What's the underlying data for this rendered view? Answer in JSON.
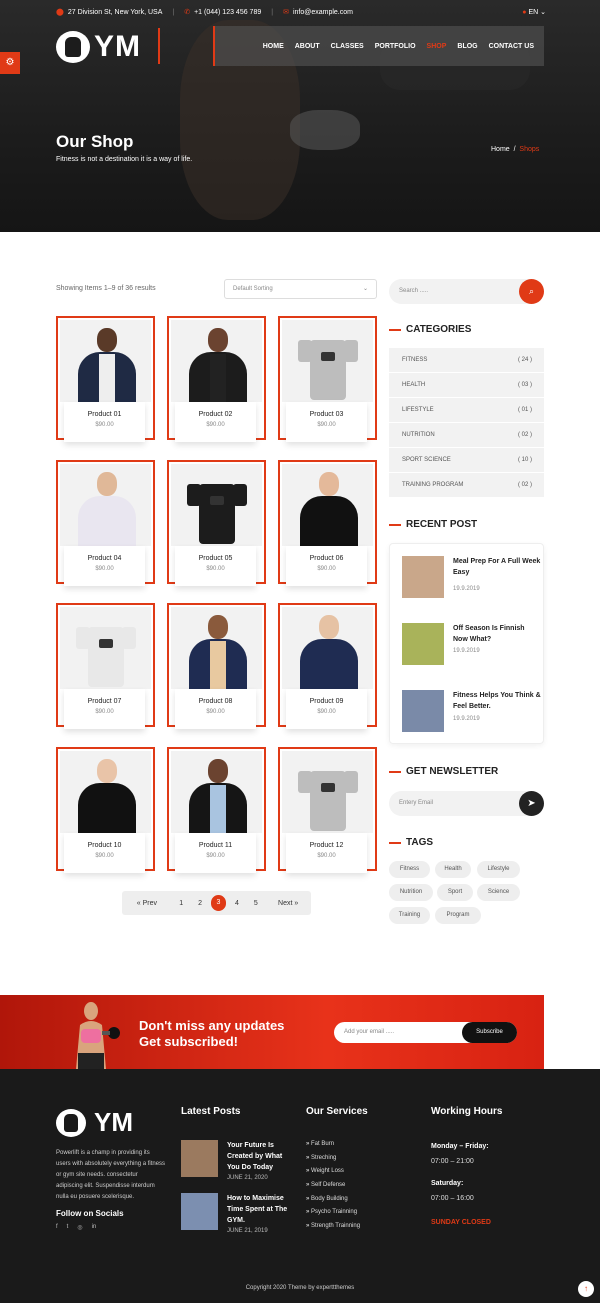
{
  "topbar": {
    "address": "27 Division St, New York, USA",
    "phone": "+1 (044) 123 456 789",
    "email": "info@example.com",
    "language": "EN"
  },
  "brand": {
    "logo_text": "YM"
  },
  "nav": [
    "HOME",
    "ABOUT",
    "CLASSES",
    "PORTFOLIO",
    "SHOP",
    "BLOG",
    "CONTACT US"
  ],
  "nav_active": "SHOP",
  "page": {
    "title": "Our Shop",
    "subtitle": "Fitness is not a destination it is a way of life.",
    "breadcrumb_home": "Home",
    "breadcrumb_sep": "/",
    "breadcrumb_current": "Shops"
  },
  "shop": {
    "showing": "Showing Items 1–9 of 36 results",
    "sort_selected": "Default Sorting",
    "products": [
      {
        "name": "Product 01",
        "price": "$90.00"
      },
      {
        "name": "Product 02",
        "price": "$90.00"
      },
      {
        "name": "Product 03",
        "price": "$90.00"
      },
      {
        "name": "Product 04",
        "price": "$90.00"
      },
      {
        "name": "Product 05",
        "price": "$90.00"
      },
      {
        "name": "Product 06",
        "price": "$90.00"
      },
      {
        "name": "Product 07",
        "price": "$90.00"
      },
      {
        "name": "Product 08",
        "price": "$90.00"
      },
      {
        "name": "Product 09",
        "price": "$90.00"
      },
      {
        "name": "Product 10",
        "price": "$90.00"
      },
      {
        "name": "Product 11",
        "price": "$90.00"
      },
      {
        "name": "Product 12",
        "price": "$90.00"
      }
    ],
    "pagination": {
      "prev": "« Prev",
      "pages": [
        "1",
        "2",
        "3",
        "4",
        "5"
      ],
      "current": "3",
      "next": "Next »"
    }
  },
  "sidebar": {
    "search_placeholder": "Search .....",
    "categories_title": "CATEGORIES",
    "categories": [
      {
        "name": "FITNESS",
        "count": "( 24 )"
      },
      {
        "name": "HEALTH",
        "count": "( 03 )"
      },
      {
        "name": "LIFESTYLE",
        "count": "( 01 )"
      },
      {
        "name": "NUTRITION",
        "count": "( 02 )"
      },
      {
        "name": "SPORT SCIENCE",
        "count": "( 10 )"
      },
      {
        "name": "TRAINING PROGRAM",
        "count": "( 02 )"
      }
    ],
    "recent_title": "RECENT POST",
    "recent_posts": [
      {
        "title": "Meal Prep For A Full Week Easy",
        "date": "19.9.2019"
      },
      {
        "title": "Off Season Is Finnish Now What?",
        "date": "19.9.2019"
      },
      {
        "title": "Fitness Helps You Think & Feel Better.",
        "date": "19.9.2019"
      }
    ],
    "newsletter_title": "GET NEWSLETTER",
    "newsletter_placeholder": "Entery Email",
    "tags_title": "TAGS",
    "tags": [
      "Fitness",
      "Health",
      "Lifestyle",
      "Nutrition",
      "Sport",
      "Science",
      "Training",
      "Program"
    ]
  },
  "subscribe": {
    "line1": "Don't miss any updates",
    "line2": "Get subscribed!",
    "placeholder": "Add your email .....",
    "button": "Subscribe"
  },
  "footer": {
    "logo_text": "YM",
    "description": "Powerlift is a champ in providing its users with absolutely everything a fitness or gym site needs. consectetur adipiscing elit. Suspendisse interdum nulla eu posuere scelerisque.",
    "follow": "Follow on Socials",
    "latest_title": "Latest Posts",
    "latest_posts": [
      {
        "title": "Your Future Is Created by What You Do Today",
        "date": "JUNE 21, 2020"
      },
      {
        "title": "How to Maximise Time Spent at The GYM.",
        "date": "JUNE 21, 2019"
      }
    ],
    "services_title": "Our Services",
    "services": [
      "Fat Burn",
      "Streching",
      "Weight Loss",
      "Self Defense",
      "Body Building",
      "Psycho Trainning",
      "Strength Trainning"
    ],
    "hours_title": "Working Hours",
    "weekday_label": "Monday – Friday:",
    "weekday_hours": "07:00 – 21:00",
    "saturday_label": "Saturday:",
    "saturday_hours": "07:00 – 16:00",
    "sunday": "SUNDAY CLOSED",
    "copyright": "Copyright 2020 Theme by experttthemes"
  }
}
